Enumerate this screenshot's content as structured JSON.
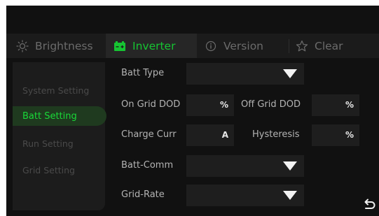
{
  "tabs": [
    {
      "label": "Brightness",
      "icon": "sun-icon"
    },
    {
      "label": "Inverter",
      "icon": "battery-icon",
      "active": true
    },
    {
      "label": "Version",
      "icon": "info-icon"
    },
    {
      "label": "Clear",
      "icon": "star-icon"
    }
  ],
  "sidebar": {
    "items": [
      {
        "label": "System Setting"
      },
      {
        "label": "Batt Setting",
        "active": true
      },
      {
        "label": "Run Setting"
      },
      {
        "label": "Grid Setting"
      }
    ]
  },
  "form": {
    "batt_type": {
      "label": "Batt Type",
      "value": ""
    },
    "on_grid_dod": {
      "label": "On Grid DOD",
      "value": "",
      "unit": "%"
    },
    "off_grid_dod": {
      "label": "Off Grid DOD",
      "value": "",
      "unit": "%"
    },
    "charge_curr": {
      "label": "Charge Curr",
      "value": "",
      "unit": "A"
    },
    "hysteresis": {
      "label": "Hysteresis",
      "value": "",
      "unit": "%"
    },
    "batt_comm": {
      "label": "Batt-Comm",
      "value": ""
    },
    "grid_rate": {
      "label": "Grid-Rate",
      "value": ""
    }
  },
  "colors": {
    "accent": "#16c432",
    "background": "#111111",
    "field": "#1e1e1e"
  }
}
